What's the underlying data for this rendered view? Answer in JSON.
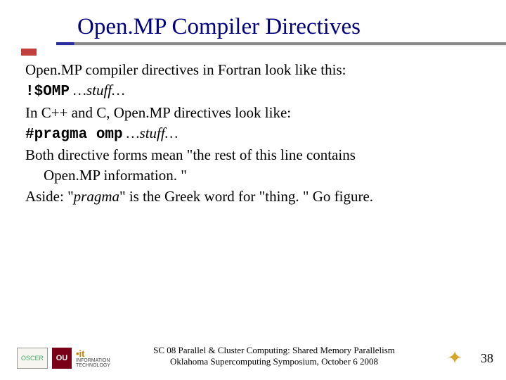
{
  "title": "Open.MP Compiler Directives",
  "body": {
    "line1": "Open.MP compiler directives in Fortran look like this:",
    "fortran_code": "!$OMP",
    "fortran_stuff": "…stuff…",
    "line2": "In C++ and C, Open.MP directives look like:",
    "c_code": "#pragma omp",
    "c_stuff": "…stuff…",
    "line3a": "Both directive forms mean \"the rest of this line contains",
    "line3b": "Open.MP information. \"",
    "aside_prefix": "Aside: \"",
    "aside_word": "pragma",
    "aside_suffix": "\" is the Greek word for \"thing. \" Go figure."
  },
  "footer": {
    "line1": "SC 08 Parallel & Cluster Computing: Shared Memory Parallelism",
    "line2": "Oklahoma Supercomputing Symposium, October 6 2008",
    "page": "38"
  },
  "logos": {
    "oscer": "OSCER",
    "ou": "OU",
    "it": "INFORMATION TECHNOLOGY"
  }
}
